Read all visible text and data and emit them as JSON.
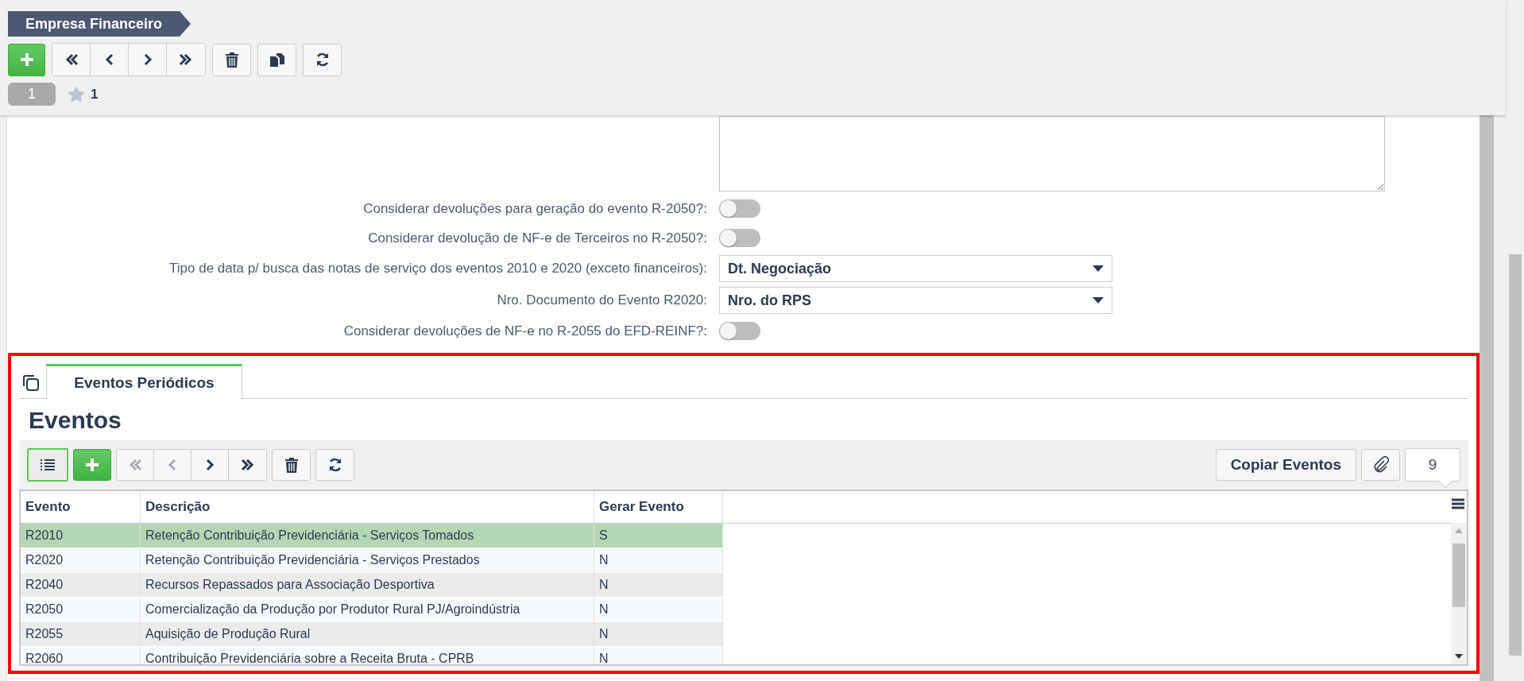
{
  "header": {
    "title": "Empresa Financeiro",
    "nav": [
      {
        "kind": "first",
        "disabled": false
      },
      {
        "kind": "prev",
        "disabled": false
      },
      {
        "kind": "next",
        "disabled": false
      },
      {
        "kind": "last",
        "disabled": false
      }
    ],
    "record_badge": "1",
    "favorites_count": "1"
  },
  "form": {
    "fields": [
      {
        "kind": "textarea"
      },
      {
        "kind": "toggle",
        "label": "Considerar devoluções para geração do evento R-2050?:",
        "on": false
      },
      {
        "kind": "toggle",
        "label": "Considerar devolução de NF-e de Terceiros no R-2050?:",
        "on": false
      },
      {
        "kind": "select",
        "label": "Tipo de data p/ busca das notas de serviço dos eventos 2010 e 2020 (exceto financeiros):",
        "value": "Dt. Negociação"
      },
      {
        "kind": "select",
        "label": "Nro. Documento do Evento R2020:",
        "value": "Nro. do RPS"
      },
      {
        "kind": "toggle",
        "label": "Considerar devoluções de NF-e no R-2055 do EFD-REINF?:",
        "on": false
      }
    ]
  },
  "detail": {
    "tabs": [
      {
        "label": "Eventos Periódicos",
        "selected": true
      }
    ],
    "heading": "Eventos",
    "toolbar": {
      "list_view_on": true,
      "nav": [
        {
          "kind": "first",
          "disabled": true
        },
        {
          "kind": "prev",
          "disabled": true
        },
        {
          "kind": "next",
          "disabled": false
        },
        {
          "kind": "last",
          "disabled": false
        }
      ],
      "copy_button": "Copiar Eventos",
      "count": "9"
    },
    "table": {
      "columns": [
        "Evento",
        "Descrição",
        "Gerar Evento"
      ],
      "rows": [
        {
          "cells": [
            "R2010",
            "Retenção Contribuição Previdenciária - Serviços Tomados",
            "S"
          ],
          "selected": true
        },
        {
          "cells": [
            "R2020",
            "Retenção Contribuição Previdenciária - Serviços Prestados",
            "N"
          ],
          "selected": false
        },
        {
          "cells": [
            "R2040",
            "Recursos Repassados para Associação Desportiva",
            "N"
          ],
          "selected": false
        },
        {
          "cells": [
            "R2050",
            "Comercialização da Produção por Produtor Rural PJ/Agroindústria",
            "N"
          ],
          "selected": false
        },
        {
          "cells": [
            "R2055",
            "Aquisição de Produção Rural",
            "N"
          ],
          "selected": false
        },
        {
          "cells": [
            "R2060",
            "Contribuição Previdenciária sobre a Receita Bruta - CPRB",
            "N"
          ],
          "selected": false
        }
      ]
    }
  }
}
